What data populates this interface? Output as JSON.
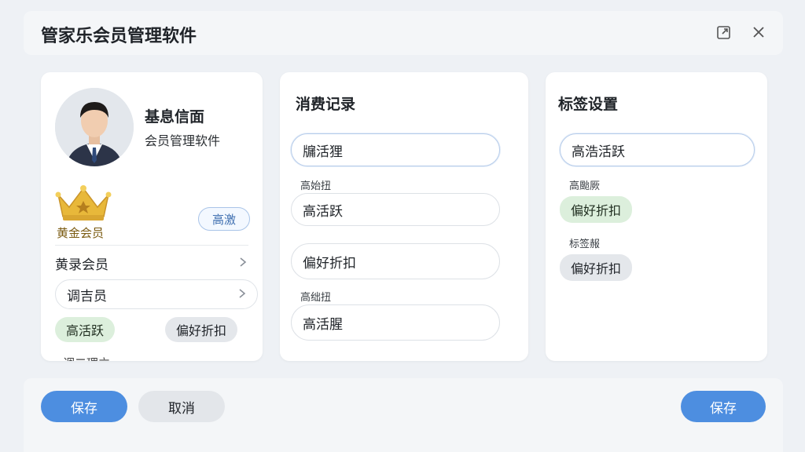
{
  "app": {
    "title": "管家乐会员管理软件"
  },
  "profile": {
    "name": "基息信面",
    "subtitle": "会员管理软件",
    "tier": "黄金会员",
    "tag_button": "高激"
  },
  "left_panel": {
    "row1_label": "黄录会员",
    "row2_label": "调吉员",
    "chip_green": "高活跃",
    "chip_gray": "偏好折扣",
    "cut_text": "调二理立"
  },
  "consumption": {
    "title": "消费记录",
    "input1": "牖活狸",
    "label1": "高始扭",
    "input2": "高活跃",
    "input3": "偏好折扣",
    "label2": "高绌扭",
    "input4": "高活腥"
  },
  "tags": {
    "title": "标签设置",
    "input1": "高浩活跃",
    "label1": "高颱厥",
    "chip_green": "偏好折扣",
    "label2": "标签赧",
    "chip_gray": "偏好折扣"
  },
  "footer": {
    "save_left": "保存",
    "cancel": "取消",
    "save_right": "保存"
  },
  "colors": {
    "primary": "#4d8ee0",
    "chip_green": "#dcefdc",
    "chip_gray": "#e4e7eb",
    "crown_gold": "#e8b83a"
  }
}
